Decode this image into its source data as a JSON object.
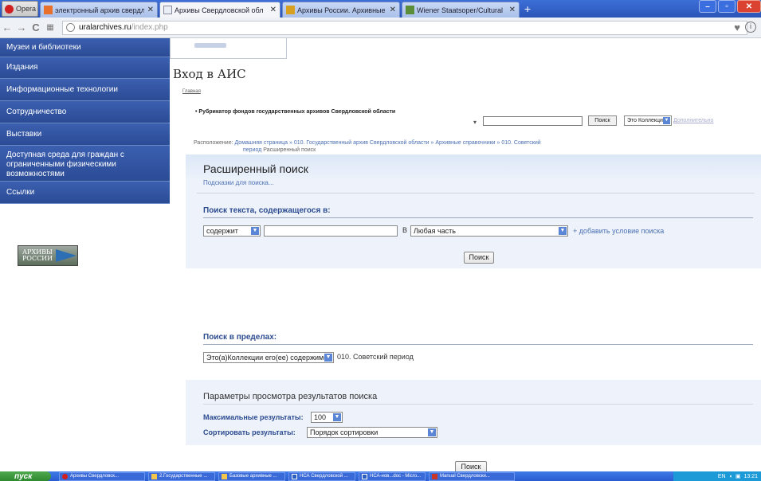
{
  "browser": {
    "opera_label": "Opera",
    "tabs": [
      {
        "label": "электронный архив свердл",
        "active": false
      },
      {
        "label": "Архивы Свердловской обл",
        "active": true
      },
      {
        "label": "Архивы России. Архивные",
        "active": false
      },
      {
        "label": "Wiener Staatsoper/Cultural",
        "active": false
      }
    ],
    "new_tab": "+",
    "address": {
      "host": "uralarchives.ru",
      "path": "/index.php"
    }
  },
  "sidebar": {
    "items": [
      "Музеи и библиотеки",
      "Издания",
      "Информационные технологии",
      "Сотрудничество",
      "Выставки",
      "Доступная среда для граждан с ограниченными физическими возможностями",
      "Ссылки"
    ],
    "logo_text": "АРХИВЫ РОССИИ"
  },
  "page": {
    "title": "Вход в АИС",
    "breadcrumb_home": "Главная",
    "rubricator": "• Рубрикатор фондов государственных архивов Свердловской области",
    "rubricator_search_button": "Поиск",
    "rubricator_scope": "Это Коллекция",
    "rubricator_more": "Дополнительно",
    "location_label": "Расположение:",
    "location_path": "Домашняя страница » 010. Государственный архив Свердловской области » Архивные справочники » 010. Советский",
    "location_path_2": "период",
    "location_current": "Расширенный поиск"
  },
  "advanced_search": {
    "title": "Расширенный поиск",
    "hints": "Подсказки для поиска...",
    "text_section_title": "Поиск текста, содержащегося в:",
    "condition_operator": "содержит",
    "condition_value": "",
    "in_label": "В",
    "condition_field": "Любая часть",
    "add_condition": "+ добавить условие поиска",
    "search_button": "Поиск",
    "scope_section_title": "Поиск в пределах:",
    "scope_select": "Это(а)Коллекции его(ее) содержимое",
    "scope_target": "010. Советский период",
    "params_title": "Параметры просмотра результатов поиска",
    "max_results_label": "Максимальные результаты:",
    "max_results_value": "100",
    "sort_label": "Сортировать результаты:",
    "sort_value": "Порядок сортировки",
    "final_search_button": "Поиск"
  },
  "taskbar": {
    "start": "пуск",
    "tasks": [
      "Архивы Свердловск...",
      "2.Государственные ...",
      "Базовые архивные ...",
      "НСА Свердловской ...",
      "НСА-нов...doc - Micro...",
      "Manual Свердловски..."
    ],
    "lang": "EN",
    "clock": "13:21"
  },
  "colors": {
    "sidebar_bg": "#2b4b95",
    "section_title": "#2b4a8f",
    "panel_bg": "#eef3fb",
    "link": "#4a6fb2"
  }
}
